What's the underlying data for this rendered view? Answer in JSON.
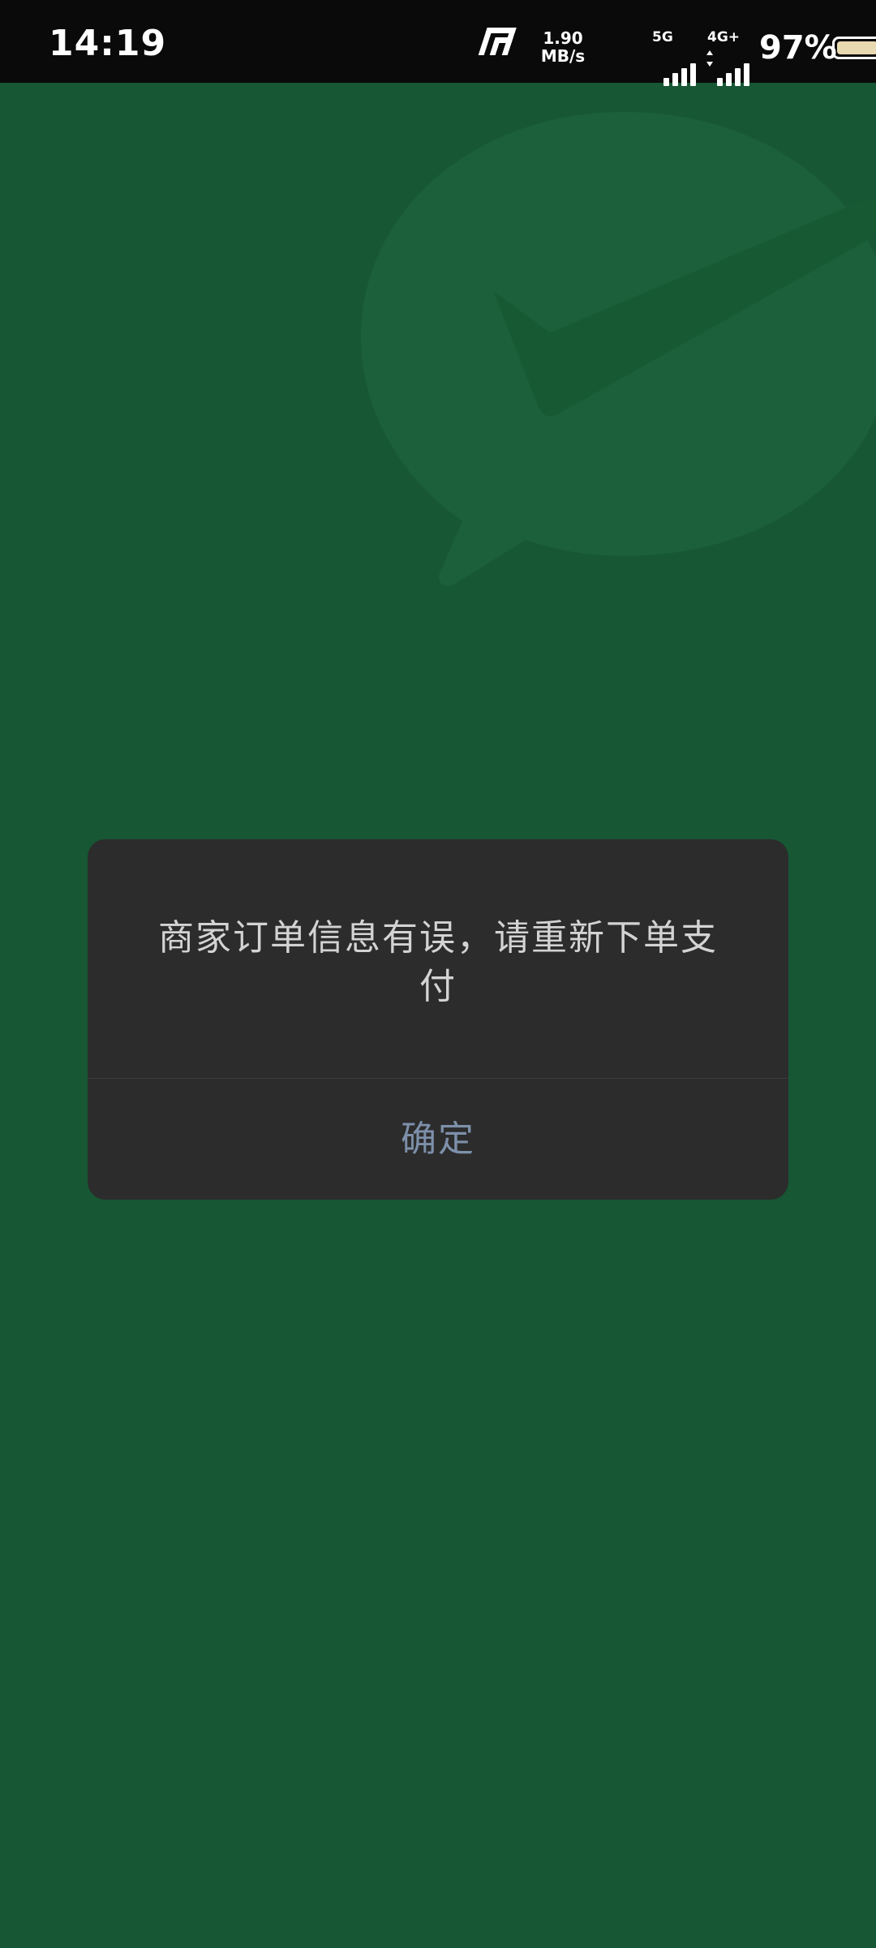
{
  "status_bar": {
    "time": "14:19",
    "net_speed_value": "1.90",
    "net_speed_unit": "MB/s",
    "sim1_label": "5G",
    "sim2_label": "4G+",
    "battery_percent_text": "97%",
    "battery_level": 0.97
  },
  "background": {
    "color": "#175734",
    "watermark_icon": "wechat-logo-icon"
  },
  "dialog": {
    "message": "商家订单信息有误，请重新下单支付",
    "confirm_label": "确定"
  },
  "colors": {
    "dialog_bg": "#2c2c2c",
    "message_text": "#d3d3d3",
    "confirm_text": "#7d90aa",
    "status_bar_bg": "#0a0a0a"
  }
}
